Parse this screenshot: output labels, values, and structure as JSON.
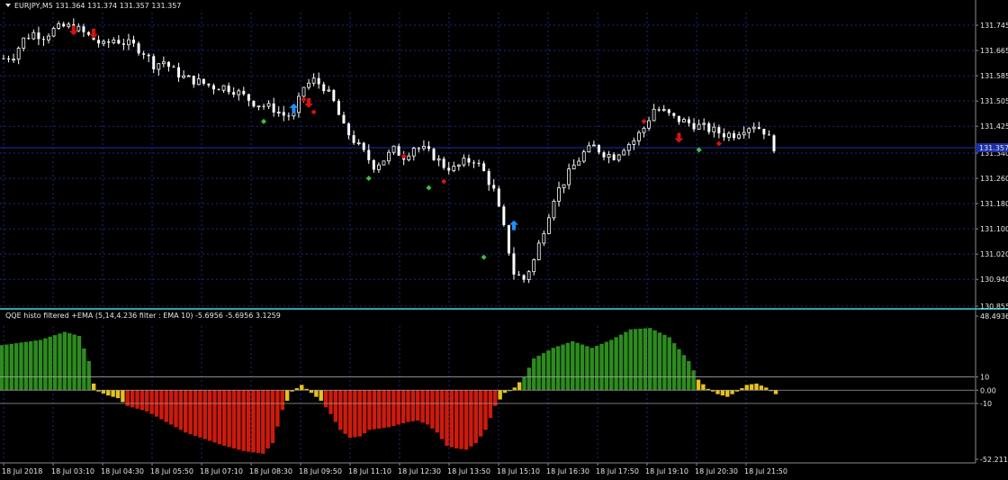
{
  "price_panel": {
    "title": "EURJPY,M5  131.364 131.374 131.357 131.357",
    "current_price_label": "131.357",
    "y_ticks": [
      "131.745",
      "131.665",
      "131.585",
      "131.505",
      "131.425",
      "131.340",
      "131.260",
      "131.180",
      "131.100",
      "131.020",
      "130.940",
      "130.855"
    ]
  },
  "indicator_panel": {
    "title": "QQE histo filtered +EMA (5,14,4.236 filter : EMA 10) -5.6956 -5.6956 3.1259",
    "y_ticks": [
      "48.4936",
      "10",
      "0.00",
      "-10",
      "-52.2113"
    ]
  },
  "x_axis": {
    "labels": [
      "18 Jul 2018",
      "18 Jul 03:10",
      "18 Jul 04:30",
      "18 Jul 05:50",
      "18 Jul 07:10",
      "18 Jul 08:30",
      "18 Jul 09:50",
      "18 Jul 11:10",
      "18 Jul 12:30",
      "18 Jul 13:50",
      "18 Jul 15:10",
      "18 Jul 16:30",
      "18 Jul 17:50",
      "18 Jul 19:10",
      "18 Jul 20:30",
      "18 Jul 21:50"
    ]
  },
  "colors": {
    "background": "#000000",
    "grid": "#1c2a78",
    "axis": "#8a8a8a",
    "separator": "#2ea6a6",
    "candle_bull": "#ffffff",
    "candle_bear": "#ffffff",
    "hist_positive": "#2e8b1f",
    "hist_negative": "#cc1b0e",
    "hist_neutral": "#e6c21a",
    "price_line": "#1d2fa8",
    "price_label_bg": "#1d2fa8",
    "arrow_up": "#1e90ff",
    "arrow_down": "#d41414",
    "diamond_green": "#3fbf3f",
    "diamond_red": "#d41414"
  },
  "chart_data": [
    {
      "type": "candlestick",
      "title": "EURJPY,M5",
      "ylim": [
        130.855,
        131.785
      ],
      "price_path": [
        [
          0,
          131.64
        ],
        [
          2,
          131.65
        ],
        [
          4,
          131.7
        ],
        [
          6,
          131.72
        ],
        [
          8,
          131.71
        ],
        [
          10,
          131.73
        ],
        [
          12,
          131.74
        ],
        [
          14,
          131.74
        ],
        [
          16,
          131.72
        ],
        [
          18,
          131.7
        ],
        [
          20,
          131.68
        ],
        [
          22,
          131.7
        ],
        [
          24,
          131.69
        ],
        [
          26,
          131.68
        ],
        [
          28,
          131.66
        ],
        [
          30,
          131.62
        ],
        [
          32,
          131.63
        ],
        [
          34,
          131.6
        ],
        [
          36,
          131.58
        ],
        [
          38,
          131.57
        ],
        [
          40,
          131.56
        ],
        [
          42,
          131.55
        ],
        [
          44,
          131.55
        ],
        [
          46,
          131.54
        ],
        [
          48,
          131.52
        ],
        [
          50,
          131.5
        ],
        [
          52,
          131.49
        ],
        [
          54,
          131.48
        ],
        [
          56,
          131.46
        ],
        [
          58,
          131.46
        ],
        [
          60,
          131.55
        ],
        [
          62,
          131.57
        ],
        [
          64,
          131.55
        ],
        [
          66,
          131.5
        ],
        [
          68,
          131.42
        ],
        [
          70,
          131.38
        ],
        [
          72,
          131.34
        ],
        [
          74,
          131.3
        ],
        [
          76,
          131.32
        ],
        [
          78,
          131.35
        ],
        [
          80,
          131.33
        ],
        [
          82,
          131.36
        ],
        [
          84,
          131.35
        ],
        [
          86,
          131.33
        ],
        [
          88,
          131.3
        ],
        [
          90,
          131.29
        ],
        [
          92,
          131.31
        ],
        [
          94,
          131.32
        ],
        [
          96,
          131.28
        ],
        [
          98,
          131.22
        ],
        [
          100,
          131.1
        ],
        [
          102,
          130.96
        ],
        [
          104,
          130.94
        ],
        [
          106,
          131.0
        ],
        [
          108,
          131.1
        ],
        [
          110,
          131.2
        ],
        [
          112,
          131.25
        ],
        [
          114,
          131.3
        ],
        [
          116,
          131.34
        ],
        [
          118,
          131.36
        ],
        [
          120,
          131.34
        ],
        [
          122,
          131.33
        ],
        [
          124,
          131.36
        ],
        [
          126,
          131.38
        ],
        [
          128,
          131.42
        ],
        [
          130,
          131.48
        ],
        [
          132,
          131.47
        ],
        [
          134,
          131.45
        ],
        [
          136,
          131.44
        ],
        [
          138,
          131.43
        ],
        [
          140,
          131.42
        ],
        [
          142,
          131.41
        ],
        [
          144,
          131.4
        ],
        [
          146,
          131.4
        ],
        [
          148,
          131.42
        ],
        [
          150,
          131.43
        ],
        [
          152,
          131.41
        ],
        [
          154,
          131.36
        ]
      ],
      "current_price": 131.357,
      "signals": [
        {
          "type": "arrow_down",
          "i": 14,
          "price": 131.73
        },
        {
          "type": "arrow_down",
          "i": 18,
          "price": 131.72
        },
        {
          "type": "diamond_green",
          "i": 52,
          "price": 131.44
        },
        {
          "type": "arrow_up",
          "i": 58,
          "price": 131.48
        },
        {
          "type": "diamond_red",
          "i": 60,
          "price": 131.51
        },
        {
          "type": "arrow_down",
          "i": 61,
          "price": 131.5
        },
        {
          "type": "diamond_red",
          "i": 62,
          "price": 131.47
        },
        {
          "type": "diamond_red",
          "i": 80,
          "price": 131.33
        },
        {
          "type": "diamond_green",
          "i": 73,
          "price": 131.26
        },
        {
          "type": "diamond_green",
          "i": 85,
          "price": 131.23
        },
        {
          "type": "diamond_red",
          "i": 88,
          "price": 131.25
        },
        {
          "type": "diamond_green",
          "i": 96,
          "price": 131.01
        },
        {
          "type": "arrow_up",
          "i": 102,
          "price": 131.11
        },
        {
          "type": "diamond_red",
          "i": 128,
          "price": 131.44
        },
        {
          "type": "arrow_down",
          "i": 135,
          "price": 131.39
        },
        {
          "type": "diamond_green",
          "i": 139,
          "price": 131.35
        },
        {
          "type": "diamond_red",
          "i": 143,
          "price": 131.37
        }
      ]
    },
    {
      "type": "bar",
      "title": "QQE histo filtered +EMA (5,14,4.236 filter : EMA 10)",
      "ylim": [
        -52.2113,
        48.4936
      ],
      "levels": [
        10,
        0,
        -10
      ],
      "profile": [
        [
          0,
          34
        ],
        [
          8,
          38
        ],
        [
          13,
          44
        ],
        [
          16,
          41
        ],
        [
          18,
          22
        ],
        [
          19,
          5
        ],
        [
          20,
          -1
        ],
        [
          22,
          -4
        ],
        [
          24,
          -6
        ],
        [
          26,
          -12
        ],
        [
          30,
          -16
        ],
        [
          34,
          -24
        ],
        [
          38,
          -32
        ],
        [
          42,
          -37
        ],
        [
          46,
          -42
        ],
        [
          50,
          -46
        ],
        [
          54,
          -48
        ],
        [
          56,
          -40
        ],
        [
          58,
          -15
        ],
        [
          60,
          -1
        ],
        [
          62,
          4
        ],
        [
          63,
          1
        ],
        [
          64,
          -2
        ],
        [
          66,
          -8
        ],
        [
          68,
          -18
        ],
        [
          70,
          -30
        ],
        [
          72,
          -36
        ],
        [
          74,
          -35
        ],
        [
          76,
          -30
        ],
        [
          80,
          -28
        ],
        [
          84,
          -24
        ],
        [
          86,
          -23
        ],
        [
          88,
          -26
        ],
        [
          90,
          -32
        ],
        [
          92,
          -42
        ],
        [
          94,
          -44
        ],
        [
          96,
          -45
        ],
        [
          98,
          -40
        ],
        [
          100,
          -30
        ],
        [
          102,
          -12
        ],
        [
          104,
          -2
        ],
        [
          106,
          2
        ],
        [
          108,
          10
        ],
        [
          110,
          24
        ],
        [
          114,
          32
        ],
        [
          118,
          37
        ],
        [
          122,
          32
        ],
        [
          126,
          38
        ],
        [
          130,
          46
        ],
        [
          134,
          47
        ],
        [
          138,
          40
        ],
        [
          142,
          22
        ],
        [
          144,
          8
        ],
        [
          146,
          1
        ],
        [
          148,
          -3
        ],
        [
          150,
          -5
        ],
        [
          152,
          -1
        ],
        [
          154,
          4
        ],
        [
          156,
          5
        ],
        [
          158,
          2
        ],
        [
          160,
          -3
        ]
      ]
    }
  ]
}
